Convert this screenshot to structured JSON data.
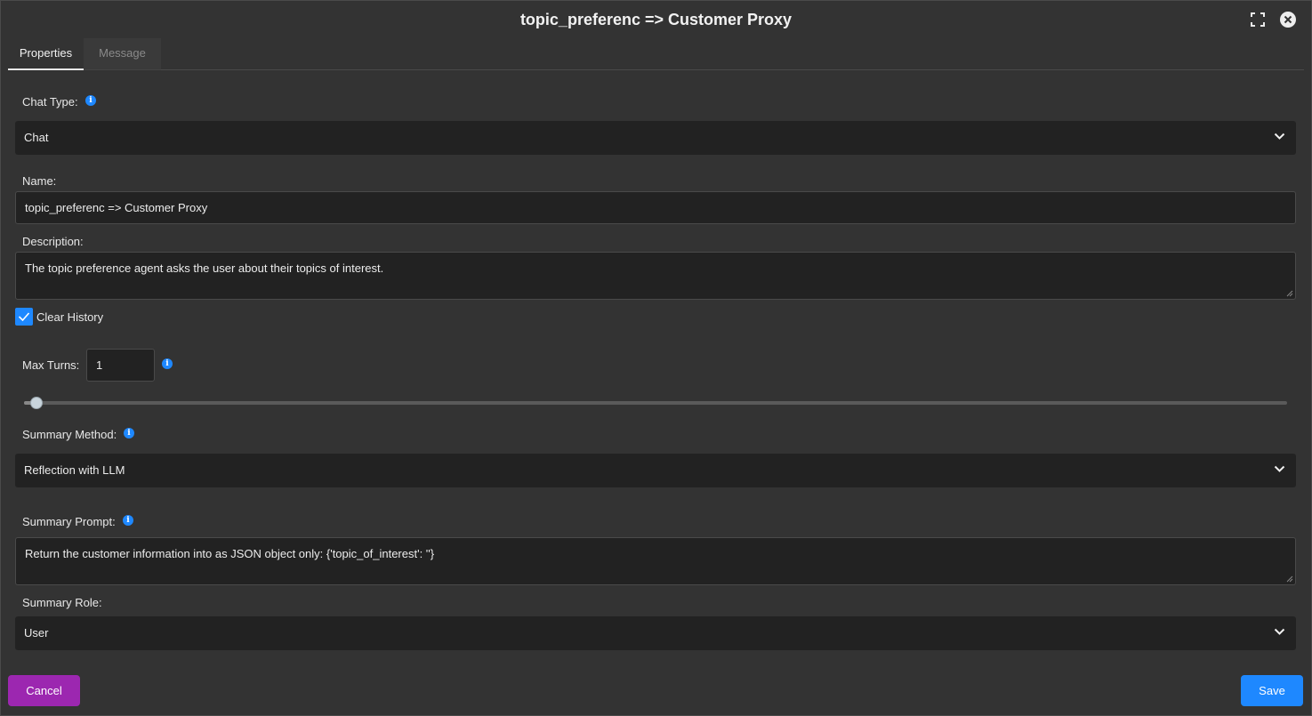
{
  "dialog": {
    "title": "topic_preferenc => Customer Proxy",
    "icons": {
      "maximize": "fullscreen-icon",
      "close": "close-circle-icon"
    }
  },
  "tabs": [
    {
      "label": "Properties",
      "active": true
    },
    {
      "label": "Message",
      "active": false
    }
  ],
  "form": {
    "chat_type": {
      "label": "Chat Type:",
      "value": "Chat"
    },
    "name": {
      "label": "Name:",
      "value": "topic_preferenc => Customer Proxy"
    },
    "description": {
      "label": "Description:",
      "value": "The topic preference agent asks the user about their topics of interest."
    },
    "clear_history": {
      "label": "Clear History",
      "checked": true
    },
    "max_turns": {
      "label": "Max Turns:",
      "value": "1",
      "slider_fraction": 0.01
    },
    "summary_method": {
      "label": "Summary Method:",
      "value": "Reflection with LLM"
    },
    "summary_prompt": {
      "label": "Summary Prompt:",
      "value": "Return the customer information into as JSON object only: {'topic_of_interest': ''}"
    },
    "summary_role": {
      "label": "Summary Role:",
      "value": "User"
    }
  },
  "footer": {
    "cancel_label": "Cancel",
    "save_label": "Save"
  },
  "colors": {
    "accent": "#1e88ff",
    "cancel": "#9c27b0",
    "panel": "#333333",
    "field": "#222222"
  }
}
